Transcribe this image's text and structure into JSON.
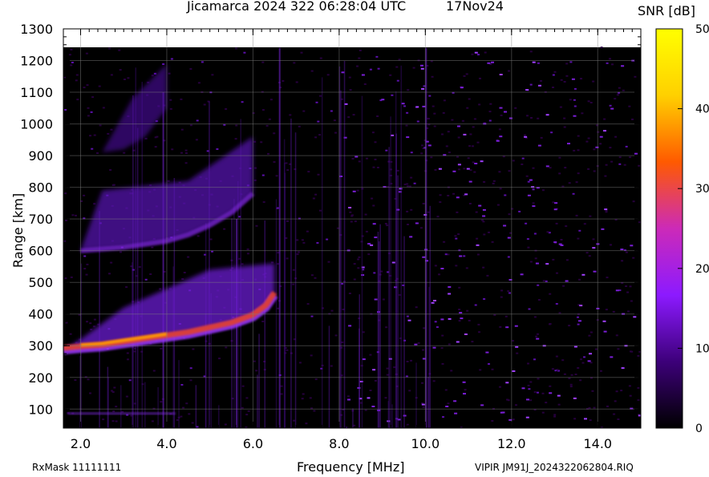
{
  "chart_data": {
    "type": "heatmap",
    "title": "Jicamarca 2024 322 06:28:04 UTC",
    "date_label": "17Nov24",
    "xlabel": "Frequency [MHz]",
    "ylabel": "Range [km]",
    "xlim": [
      1.6,
      15.0
    ],
    "ylim": [
      40,
      1300
    ],
    "x_ticks": [
      "2.0",
      "4.0",
      "6.0",
      "8.0",
      "10.0",
      "12.0",
      "14.0"
    ],
    "y_ticks": [
      "100",
      "200",
      "300",
      "400",
      "500",
      "600",
      "700",
      "800",
      "900",
      "1000",
      "1100",
      "1200",
      "1300"
    ],
    "grid": true,
    "colorbar": {
      "label": "SNR [dB]",
      "range": [
        0,
        50
      ],
      "ticks": [
        "0",
        "10",
        "20",
        "30",
        "40",
        "50"
      ],
      "colormap": [
        "#000000",
        "#3d007a",
        "#8c1aff",
        "#cc2ab8",
        "#ff5a00",
        "#ffd000",
        "#ffff00"
      ]
    },
    "traces": [
      {
        "name": "",
        "x": [
          1.6,
          2.0,
          2.5,
          3.0,
          3.5,
          4.0,
          4.5,
          5.0,
          5.5,
          6.0,
          6.3,
          6.5
        ],
        "y": [
          285,
          290,
          295,
          305,
          315,
          325,
          335,
          350,
          365,
          390,
          420,
          460
        ]
      },
      {
        "name": "",
        "x": [
          2.0,
          2.5,
          3.0,
          3.5,
          4.0,
          4.5,
          5.0,
          5.5,
          6.0
        ],
        "y": [
          600,
          605,
          610,
          620,
          630,
          650,
          680,
          720,
          780
        ]
      },
      {
        "name": "",
        "x": [
          2.5,
          3.0,
          3.5,
          4.0
        ],
        "y": [
          910,
          920,
          960,
          1050
        ]
      }
    ]
  },
  "footer": {
    "rxmask": "RxMask 11111111",
    "file": "VIPIR  JM91J_2024322062804.RIQ"
  }
}
